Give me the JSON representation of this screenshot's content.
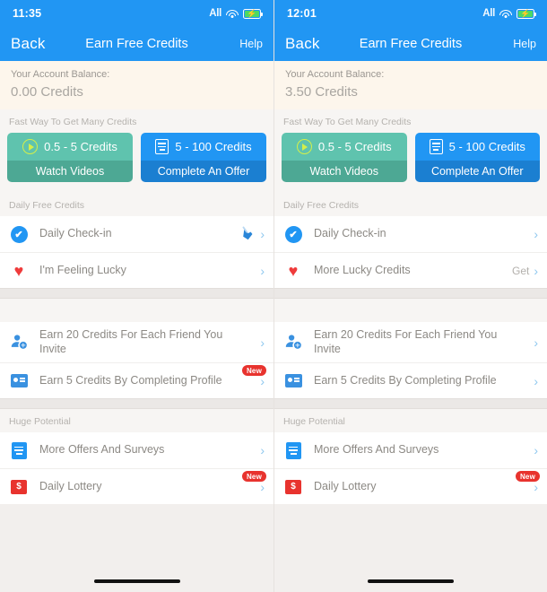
{
  "panels": [
    {
      "name": "before",
      "status": {
        "time": "11:35",
        "carrier": "All",
        "wifi_icon": "wifi-icon",
        "battery_icon": "battery-charging-icon"
      },
      "nav": {
        "back": "Back",
        "title": "Earn Free Credits",
        "help": "Help"
      },
      "balance": {
        "label": "Your Account Balance:",
        "value": "0.00 Credits"
      },
      "promo": {
        "heading": "Fast Way To Get Many Credits",
        "cards": [
          {
            "credits": "0.5 - 5 Credits",
            "label": "Watch Videos",
            "icon": "play-circle-icon",
            "color": "#5fc3ae"
          },
          {
            "credits": "5 - 100 Credits",
            "label": "Complete An Offer",
            "icon": "document-icon",
            "color": "#2196f3"
          }
        ]
      },
      "sections": [
        {
          "heading": "Daily Free Credits",
          "rows": [
            {
              "icon": "check-circle-icon",
              "label": "Daily Check-in",
              "action": "",
              "badge": "",
              "chevron": "›",
              "cursor": true
            },
            {
              "icon": "heart-icon",
              "label": "I'm Feeling Lucky",
              "action": "",
              "badge": "",
              "chevron": "›",
              "cursor": false
            }
          ]
        },
        {
          "heading": "",
          "rows": [
            {
              "icon": "person-add-icon",
              "label": "Earn 20 Credits For Each Friend You Invite",
              "action": "",
              "badge": "",
              "chevron": "›",
              "cursor": false
            },
            {
              "icon": "id-card-icon",
              "label": "Earn 5 Credits By Completing Profile",
              "action": "",
              "badge": "New",
              "chevron": "›",
              "cursor": false
            }
          ]
        },
        {
          "heading": "Huge Potential",
          "rows": [
            {
              "icon": "document-blue-icon",
              "label": "More Offers And Surveys",
              "action": "",
              "badge": "",
              "chevron": "›",
              "cursor": false
            },
            {
              "icon": "money-icon",
              "label": "Daily Lottery",
              "action": "",
              "badge": "New",
              "chevron": "›",
              "cursor": false
            }
          ]
        }
      ]
    },
    {
      "name": "after",
      "status": {
        "time": "12:01",
        "carrier": "All",
        "wifi_icon": "wifi-icon",
        "battery_icon": "battery-charging-icon"
      },
      "nav": {
        "back": "Back",
        "title": "Earn Free Credits",
        "help": "Help"
      },
      "balance": {
        "label": "Your Account Balance:",
        "value": "3.50 Credits"
      },
      "promo": {
        "heading": "Fast Way To Get Many Credits",
        "cards": [
          {
            "credits": "0.5 - 5 Credits",
            "label": "Watch Videos",
            "icon": "play-circle-icon",
            "color": "#5fc3ae"
          },
          {
            "credits": "5 - 100 Credits",
            "label": "Complete An Offer",
            "icon": "document-icon",
            "color": "#2196f3"
          }
        ]
      },
      "sections": [
        {
          "heading": "Daily Free Credits",
          "rows": [
            {
              "icon": "check-circle-icon",
              "label": "Daily Check-in",
              "action": "",
              "badge": "",
              "chevron": "›",
              "cursor": false
            },
            {
              "icon": "heart-icon",
              "label": "More Lucky Credits",
              "action": "Get",
              "badge": "",
              "chevron": "›",
              "cursor": false
            }
          ]
        },
        {
          "heading": "",
          "rows": [
            {
              "icon": "person-add-icon",
              "label": "Earn 20 Credits For Each Friend You Invite",
              "action": "",
              "badge": "",
              "chevron": "›",
              "cursor": false
            },
            {
              "icon": "id-card-icon",
              "label": "Earn 5 Credits By Completing Profile",
              "action": "",
              "badge": "",
              "chevron": "›",
              "cursor": false
            }
          ]
        },
        {
          "heading": "Huge Potential",
          "rows": [
            {
              "icon": "document-blue-icon",
              "label": "More Offers And Surveys",
              "action": "",
              "badge": "",
              "chevron": "›",
              "cursor": false
            },
            {
              "icon": "money-icon",
              "label": "Daily Lottery",
              "action": "",
              "badge": "New",
              "chevron": "›",
              "cursor": false
            }
          ]
        }
      ]
    }
  ],
  "glyphs": {
    "check": "✔",
    "heart": "♥",
    "person_add": "☿",
    "dollar": "$",
    "chevron": "›",
    "bolt": "⚡"
  }
}
